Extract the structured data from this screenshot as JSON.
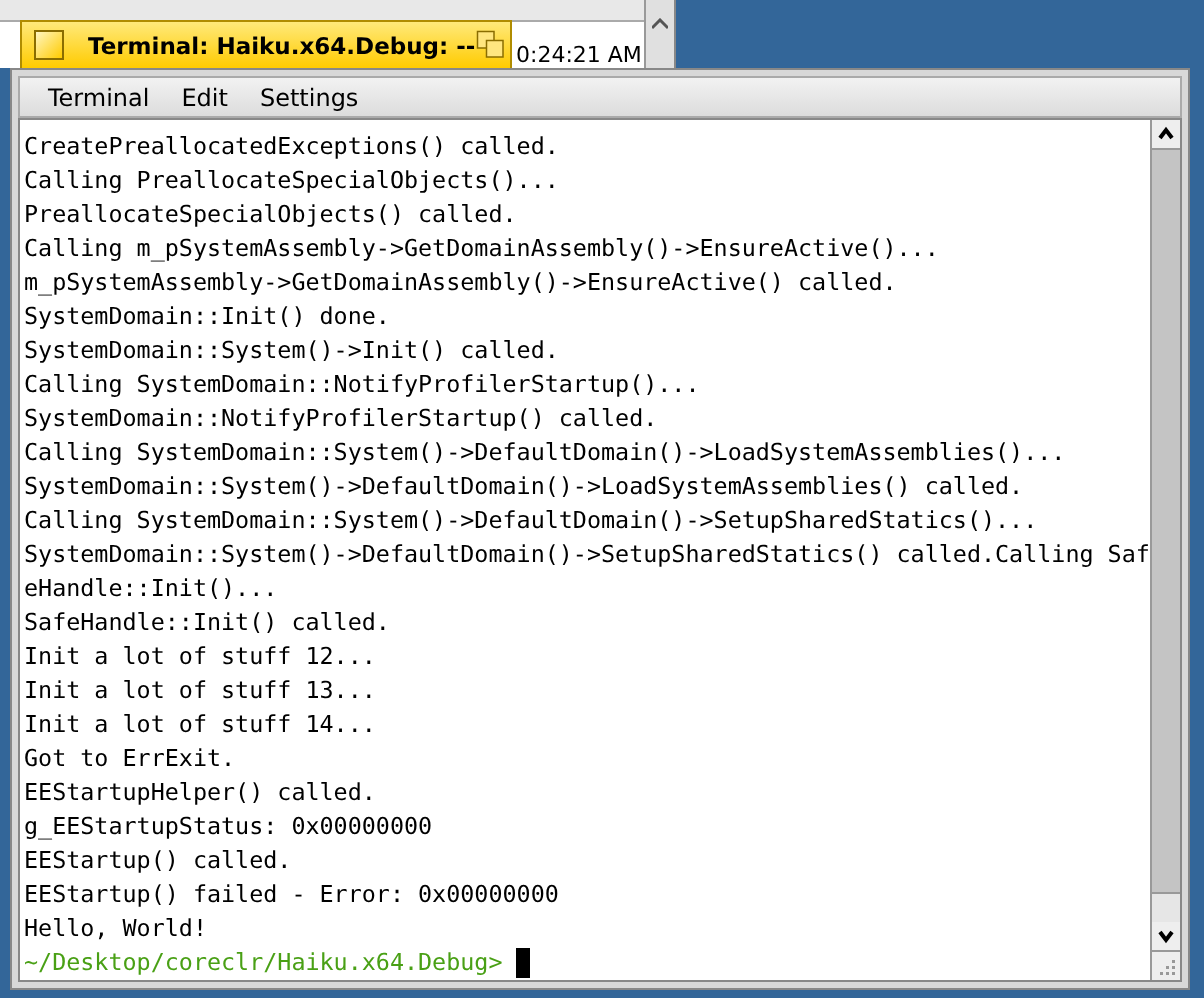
{
  "background_window": {
    "cell": "0:24:21 AM"
  },
  "window": {
    "title": "Terminal: Haiku.x64.Debug: --"
  },
  "menu": [
    "Terminal",
    "Edit",
    "Settings"
  ],
  "terminal": {
    "lines": [
      "CreatePreallocatedExceptions() called.",
      "Calling PreallocateSpecialObjects()...",
      "PreallocateSpecialObjects() called.",
      "Calling m_pSystemAssembly->GetDomainAssembly()->EnsureActive()...",
      "m_pSystemAssembly->GetDomainAssembly()->EnsureActive() called.",
      "SystemDomain::Init() done.",
      "SystemDomain::System()->Init() called.",
      "Calling SystemDomain::NotifyProfilerStartup()...",
      "SystemDomain::NotifyProfilerStartup() called.",
      "Calling SystemDomain::System()->DefaultDomain()->LoadSystemAssemblies()...",
      "SystemDomain::System()->DefaultDomain()->LoadSystemAssemblies() called.",
      "Calling SystemDomain::System()->DefaultDomain()->SetupSharedStatics()...",
      "SystemDomain::System()->DefaultDomain()->SetupSharedStatics() called.Calling Saf",
      "eHandle::Init()...",
      "SafeHandle::Init() called.",
      "Init a lot of stuff 12...",
      "Init a lot of stuff 13...",
      "Init a lot of stuff 14...",
      "Got to ErrExit.",
      "EEStartupHelper() called.",
      "g_EEStartupStatus: 0x00000000",
      "EEStartup() called.",
      "EEStartup() failed - Error: 0x00000000",
      "Hello, World!"
    ],
    "prompt": "~/Desktop/coreclr/Haiku.x64.Debug>"
  }
}
